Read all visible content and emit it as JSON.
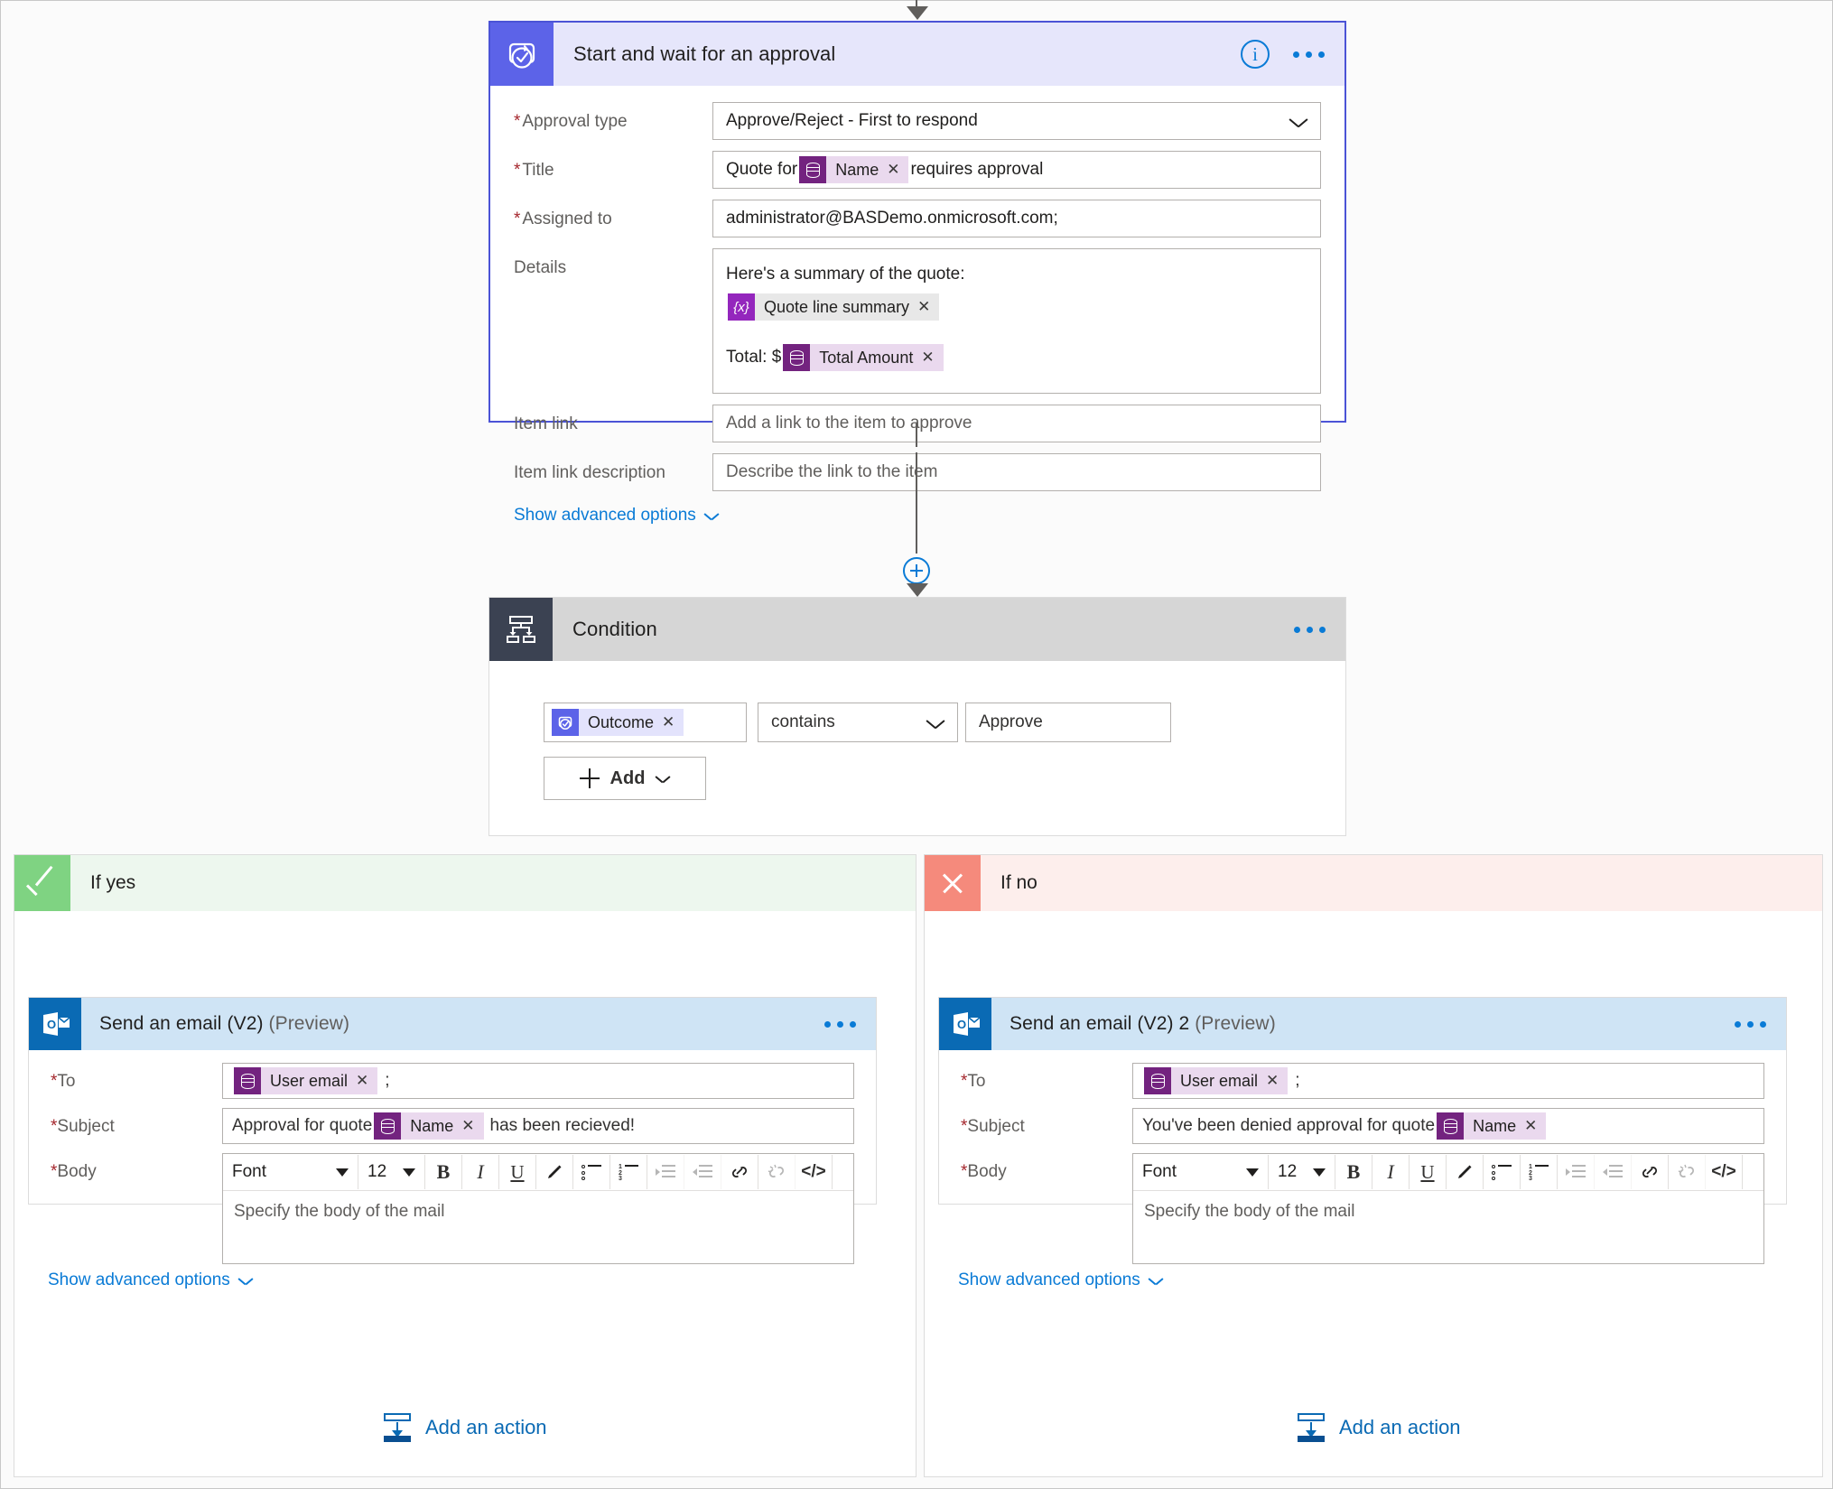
{
  "approval": {
    "title": "Start and wait for an approval",
    "icon": "approval-icon",
    "info_icon": "info-icon",
    "more_icon": "more-options-icon",
    "fields": {
      "approval_type": {
        "label": "Approval type",
        "required": true,
        "value": "Approve/Reject - First to respond"
      },
      "title": {
        "label": "Title",
        "required": true,
        "prefix": "Quote for",
        "token": "Name",
        "suffix": "requires approval"
      },
      "assigned_to": {
        "label": "Assigned to",
        "required": true,
        "value": "administrator@BASDemo.onmicrosoft.com;"
      },
      "details": {
        "label": "Details",
        "line1": "Here's a summary of the quote:",
        "token1": "Quote line summary",
        "line2_prefix": "Total: $",
        "token2": "Total Amount"
      },
      "item_link": {
        "label": "Item link",
        "required": false,
        "placeholder": "Add a link to the item to approve"
      },
      "item_link_description": {
        "label": "Item link description",
        "required": false,
        "placeholder": "Describe the link to the item"
      }
    },
    "advanced_link": "Show advanced options"
  },
  "condition": {
    "title": "Condition",
    "icon": "condition-icon",
    "more_icon": "more-options-icon",
    "row": {
      "token": "Outcome",
      "operator": "contains",
      "value": "Approve"
    },
    "add_button": "Add"
  },
  "branches": {
    "yes": {
      "label": "If yes",
      "icon": "checkmark-icon",
      "header_bg": "#edf7ee",
      "icon_bg": "#7fd382",
      "email": {
        "title": "Send an email (V2)",
        "preview": "(Preview)",
        "icon": "outlook-icon",
        "more_icon": "more-options-icon",
        "to": {
          "label": "To",
          "required": true,
          "token": "User email",
          "trailing": ";"
        },
        "subject": {
          "label": "Subject",
          "required": true,
          "prefix": "Approval for quote",
          "token": "Name",
          "suffix": "has been recieved!"
        },
        "body": {
          "label": "Body",
          "required": true,
          "placeholder": "Specify the body of the mail"
        },
        "advanced_link": "Show advanced options"
      },
      "add_action": "Add an action"
    },
    "no": {
      "label": "If no",
      "icon": "cross-icon",
      "header_bg": "#fdeeec",
      "icon_bg": "#f58a7c",
      "email": {
        "title": "Send an email (V2) 2",
        "preview": "(Preview)",
        "icon": "outlook-icon",
        "more_icon": "more-options-icon",
        "to": {
          "label": "To",
          "required": true,
          "token": "User email",
          "trailing": ";"
        },
        "subject": {
          "label": "Subject",
          "required": true,
          "prefix": "You've been denied approval for quote",
          "token": "Name",
          "suffix": ""
        },
        "body": {
          "label": "Body",
          "required": true,
          "placeholder": "Specify the body of the mail"
        },
        "advanced_link": "Show advanced options"
      },
      "add_action": "Add an action"
    }
  },
  "rich_text_toolbar": {
    "font_label": "Font",
    "size_label": "12",
    "buttons": [
      "bold",
      "italic",
      "underline",
      "text-color",
      "bulleted-list",
      "numbered-list",
      "indent",
      "outdent",
      "link",
      "unlink",
      "code-view"
    ]
  },
  "colors": {
    "approval_accent": "#5c63e8",
    "approval_header_bg": "#e6e6fb",
    "condition_badge": "#3b4252",
    "condition_header_bg": "#d6d6d6",
    "outlook_blue": "#0a6ab4",
    "email_header_bg": "#cfe4f5",
    "link_blue": "#0a7bd6",
    "required_red": "#a4262c",
    "token_purple": "#73237f",
    "token_bg": "#ead9ee"
  }
}
